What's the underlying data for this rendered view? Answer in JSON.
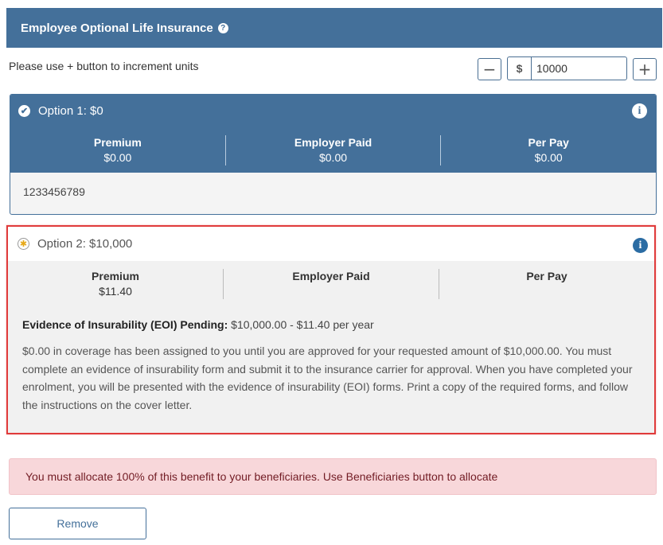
{
  "panel": {
    "title": "Employee Optional Life Insurance",
    "help_icon_glyph": "?"
  },
  "units": {
    "instruction": "Please use + button to increment units",
    "minus_label": "−",
    "plus_label": "+",
    "currency_symbol": "$",
    "amount_value": "10000"
  },
  "option1": {
    "title": "Option 1: $0",
    "selected_icon": "check-circle-icon",
    "info_glyph": "i",
    "columns": [
      {
        "label": "Premium",
        "value": "$0.00"
      },
      {
        "label": "Employer Paid",
        "value": "$0.00"
      },
      {
        "label": "Per Pay",
        "value": "$0.00"
      }
    ],
    "body_text": "1233456789"
  },
  "option2": {
    "title": "Option 2: $10,000",
    "pending_icon": "pending-star-icon",
    "info_glyph": "i",
    "columns": [
      {
        "label": "Premium",
        "value": "$11.40"
      },
      {
        "label": "Employer Paid",
        "value": ""
      },
      {
        "label": "Per Pay",
        "value": ""
      }
    ],
    "eoi_label": "Evidence of Insurability (EOI) Pending:",
    "eoi_value": "$10,000.00 - $11.40 per year",
    "eoi_paragraph": "$0.00 in coverage has been assigned to you until you are approved for your requested amount of $10,000.00. You must complete an evidence of insurability form and submit it to the insurance carrier for approval. When you have completed your enrolment, you will be presented with the evidence of insurability (EOI) forms. Print a copy of the required forms, and follow the instructions on the cover letter."
  },
  "alert": {
    "message": "You must allocate 100% of this benefit to your beneficiaries. Use Beneficiaries button to allocate"
  },
  "actions": {
    "remove_label": "Remove"
  },
  "colors": {
    "header_blue": "#44709a",
    "highlight_red": "#e03b3b",
    "alert_bg": "#f8d7da",
    "alert_text": "#721c24"
  }
}
